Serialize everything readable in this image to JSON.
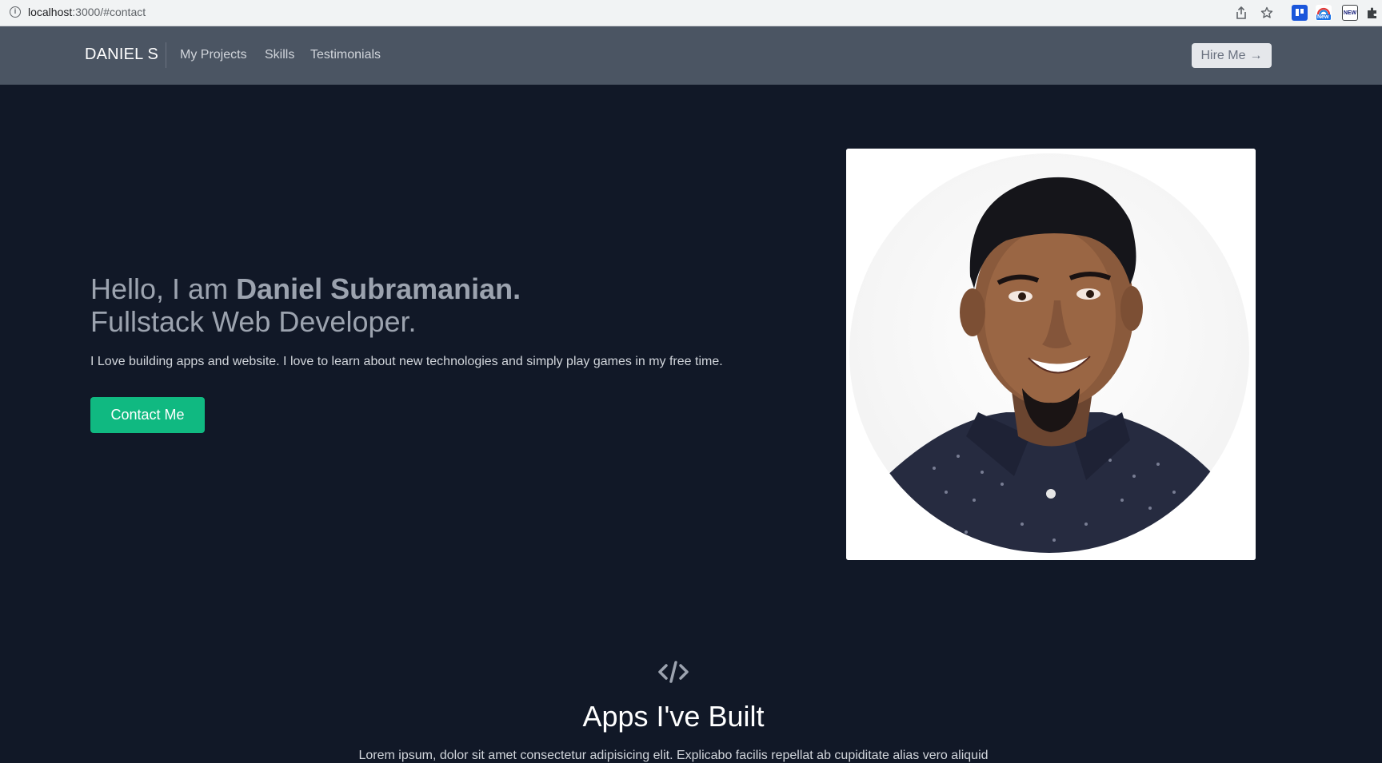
{
  "browser": {
    "url_host": "localhost",
    "url_path": ":3000/#contact",
    "extension_badge": "New",
    "extension_badge2": "NEW"
  },
  "nav": {
    "brand": "DANIEL S",
    "links": [
      "My Projects",
      "Skills",
      "Testimonials"
    ],
    "hire_label": "Hire Me",
    "hire_arrow": "→"
  },
  "hero": {
    "greeting_prefix": "Hello, I am ",
    "name": "Daniel Subramanian.",
    "role": "Fullstack Web Developer.",
    "description": "I Love building apps and website. I love to learn about new technologies and simply play games in my free time.",
    "cta_label": "Contact Me"
  },
  "projects_section": {
    "icon": "code-icon",
    "title": "Apps I've Built",
    "description": "Lorem ipsum, dolor sit amet consectetur adipisicing elit. Explicabo facilis repellat ab cupiditate alias vero aliquid"
  },
  "colors": {
    "page_bg": "#111827",
    "nav_bg": "#4b5563",
    "accent": "#10b981"
  }
}
